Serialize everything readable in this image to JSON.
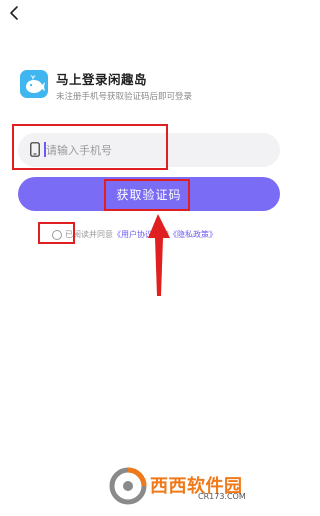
{
  "header": {
    "back_icon": "chevron-left-icon"
  },
  "brand": {
    "logo_icon": "whale-logo-icon",
    "title": "马上登录闲趣岛",
    "subtitle": "未注册手机号获取验证码后即可登录",
    "logo_color": "#3fb6f0"
  },
  "phone": {
    "icon": "phone-icon",
    "placeholder": "请输入手机号",
    "value": ""
  },
  "actions": {
    "get_code_label": "获取验证码",
    "button_color": "#7b6cf6"
  },
  "agreement": {
    "prefix": "已阅读并同意",
    "user_agreement": "《用户协议》",
    "and": "和",
    "privacy_policy": "《隐私政策》",
    "link_color": "#6b5cf5"
  },
  "annotations": {
    "highlight_color": "#e02020"
  },
  "watermark": {
    "text": "西西软件园",
    "url": "CR173.COM"
  }
}
